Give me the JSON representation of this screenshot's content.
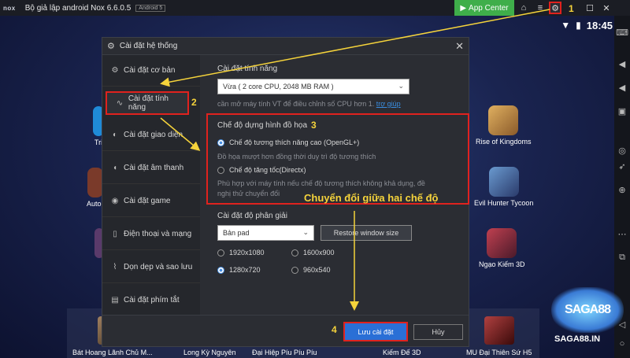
{
  "titlebar": {
    "logo": "nox",
    "title": "Bộ giả lập android Nox 6.6.0.5",
    "version_badge": "Android 5",
    "app_center_label": "App Center",
    "app_center_icon": "play-icon"
  },
  "statusbar": {
    "time": "18:45"
  },
  "desktop_apps": [
    {
      "label": "Tri",
      "color": "#1f8ad8"
    },
    {
      "label": "Autor",
      "color": "#7a3a2a"
    },
    {
      "label": "Rise of Kingdoms",
      "color": "#c98a3a"
    },
    {
      "label": "Evil Hunter Tycoon",
      "color": "#3a5a8a"
    },
    {
      "label": "Ngạo Kiếm 3D",
      "color": "#8a2a3a"
    }
  ],
  "dock_apps": [
    {
      "label": "Bát Hoang Lãnh Chủ M...",
      "color": "#5a4a3a"
    },
    {
      "label": "Long Kỳ Nguyên",
      "color": "#4a5a7a"
    },
    {
      "label": "Đại Hiệp Píu Píu Píu",
      "color": "#8a6a3a"
    },
    {
      "label": "Kiếm Đế 3D",
      "color": "#6a3a5a"
    },
    {
      "label": "MU Đại Thiên Sứ H5",
      "color": "#6a2a2a"
    }
  ],
  "dialog": {
    "title": "Cài đặt hệ thống",
    "nav": [
      {
        "label": "Cài đặt cơ bản",
        "icon": "gear-icon"
      },
      {
        "label": "Cài đặt tính năng",
        "icon": "pulse-icon"
      },
      {
        "label": "Cài đặt giao diện",
        "icon": "palette-icon"
      },
      {
        "label": "Cài đặt âm thanh",
        "icon": "speaker-icon"
      },
      {
        "label": "Cài đặt game",
        "icon": "gamepad-icon"
      },
      {
        "label": "Điện thoại và mạng",
        "icon": "phone-icon"
      },
      {
        "label": "Dọn dẹp và sao lưu",
        "icon": "broom-icon"
      },
      {
        "label": "Cài đặt phím tắt",
        "icon": "keyboard-icon"
      }
    ],
    "performance": {
      "title": "Cài đặt tính năng",
      "selected": "Vừa ( 2 core CPU, 2048 MB RAM )",
      "hint": "cần mở máy tính VT để điều chỉnh số CPU hơn 1.",
      "help_link": "trợ giúp"
    },
    "render": {
      "title": "Chế độ dựng hình đồ họa",
      "option1": "Chế độ tương thích năng cao (OpenGL+)",
      "option1_desc": "Đồ họa mượt hơn đồng thời duy trì độ tương thích",
      "option2": "Chế độ tăng tốc(Directx)",
      "option2_desc_line1": "Phù hợp với máy tính nếu chế độ tương thích không khả dụng, đề",
      "option2_desc_line2": "nghị thử chuyển đổi",
      "selected": "option1"
    },
    "resolution": {
      "title": "Cài đặt độ phân giải",
      "selected": "Bản pad",
      "restore_label": "Restore window size",
      "options": [
        "1920x1080",
        "1600x900",
        "1280x720",
        "960x540"
      ],
      "selected_option": "1280x720"
    },
    "save_label": "Lưu cài đặt",
    "cancel_label": "Hủy"
  },
  "annotations": {
    "n1": "1",
    "n2": "2",
    "n3": "3",
    "n4": "4",
    "callout": "Chuyển đổi giữa hai chế độ",
    "color": "#f5d33b",
    "box_color": "#e0221e"
  },
  "watermark": {
    "logo": "SAGA88",
    "url": "SAGA88.IN"
  }
}
